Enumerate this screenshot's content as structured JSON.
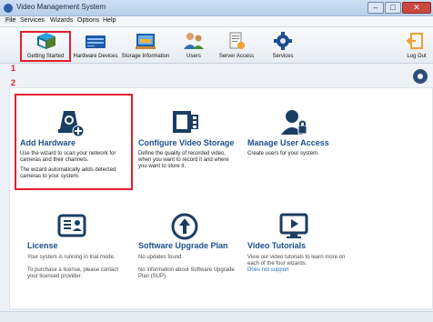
{
  "window": {
    "title": "Video Management System"
  },
  "menu": {
    "items": [
      "File",
      "Services",
      "Wizards",
      "Options",
      "Help"
    ]
  },
  "toolbar": {
    "items": [
      {
        "label": "Getting Started",
        "icon": "book-icon"
      },
      {
        "label": "Hardware Devices",
        "icon": "server-icon"
      },
      {
        "label": "Storage Information",
        "icon": "storage-icon"
      },
      {
        "label": "Users",
        "icon": "users-icon"
      },
      {
        "label": "Server Access",
        "icon": "server-access-icon"
      },
      {
        "label": "Services",
        "icon": "gear-icon"
      },
      {
        "label": "Log Out",
        "icon": "logout-icon"
      }
    ]
  },
  "annotations": {
    "one": "1",
    "two": "2"
  },
  "panels": {
    "add_hardware": {
      "title": "Add Hardware",
      "text1": "Use the wizard to scan your network for cameras and their channels.",
      "text2": "The wizard automatically adds detected cameras to your system."
    },
    "configure_storage": {
      "title": "Configure Video Storage",
      "text1": "Define the quality of recorded video, when you want to record it and where you want to store it."
    },
    "manage_users": {
      "title": "Manage User Access",
      "text1": "Create users for your system."
    },
    "license": {
      "title": "License",
      "text1": "Your system is running in trial mode.",
      "text2": "To purchase a license, please contact your licensed provider."
    },
    "upgrade": {
      "title": "Software Upgrade Plan",
      "text1": "No updates found.",
      "text2": "No information about Software Upgrade Plan (SUP)."
    },
    "tutorials": {
      "title": "Video Tutorials",
      "text1": "View our video tutorials to learn more on each of the four wizards.",
      "link": "Does not support"
    }
  },
  "colors": {
    "accent": "#1a4f8b",
    "highlight": "#e0202e",
    "link": "#1d6fd1"
  }
}
